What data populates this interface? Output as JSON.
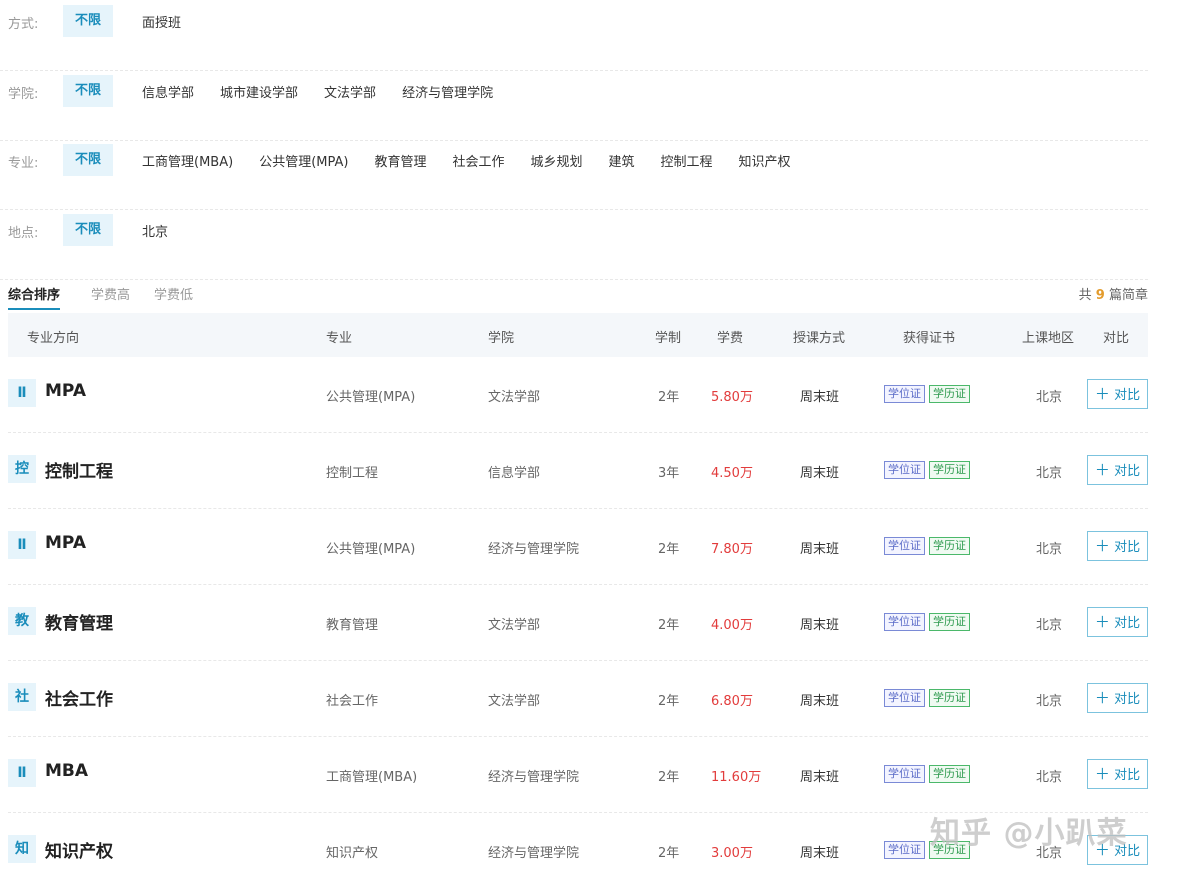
{
  "filters": [
    {
      "label": "方式:",
      "options": [
        "不限",
        "面授班"
      ]
    },
    {
      "label": "学院:",
      "options": [
        "不限",
        "信息学部",
        "城市建设学部",
        "文法学部",
        "经济与管理学院"
      ]
    },
    {
      "label": "专业:",
      "options": [
        "不限",
        "工商管理(MBA)",
        "公共管理(MPA)",
        "教育管理",
        "社会工作",
        "城乡规划",
        "建筑",
        "控制工程",
        "知识产权"
      ]
    },
    {
      "label": "地点:",
      "options": [
        "不限",
        "北京"
      ]
    }
  ],
  "sort": {
    "tabs": [
      "综合排序",
      "学费高",
      "学费低"
    ],
    "count_prefix": "共",
    "count": "9",
    "count_suffix": "篇简章"
  },
  "table": {
    "headers": [
      "专业方向",
      "专业",
      "学院",
      "学制",
      "学费",
      "授课方式",
      "获得证书",
      "上课地区",
      "对比"
    ],
    "rows": [
      {
        "icon": "Ⅱ",
        "title": "MPA",
        "major": "公共管理(MPA)",
        "college": "文法学部",
        "years": "2年",
        "fee": "5.80万",
        "mode": "周末班",
        "certs": [
          "学位证",
          "学历证"
        ],
        "region": "北京",
        "compare": "对比"
      },
      {
        "icon": "控",
        "title": "控制工程",
        "major": "控制工程",
        "college": "信息学部",
        "years": "3年",
        "fee": "4.50万",
        "mode": "周末班",
        "certs": [
          "学位证",
          "学历证"
        ],
        "region": "北京",
        "compare": "对比"
      },
      {
        "icon": "Ⅱ",
        "title": "MPA",
        "major": "公共管理(MPA)",
        "college": "经济与管理学院",
        "years": "2年",
        "fee": "7.80万",
        "mode": "周末班",
        "certs": [
          "学位证",
          "学历证"
        ],
        "region": "北京",
        "compare": "对比"
      },
      {
        "icon": "教",
        "title": "教育管理",
        "major": "教育管理",
        "college": "文法学部",
        "years": "2年",
        "fee": "4.00万",
        "mode": "周末班",
        "certs": [
          "学位证",
          "学历证"
        ],
        "region": "北京",
        "compare": "对比"
      },
      {
        "icon": "社",
        "title": "社会工作",
        "major": "社会工作",
        "college": "文法学部",
        "years": "2年",
        "fee": "6.80万",
        "mode": "周末班",
        "certs": [
          "学位证",
          "学历证"
        ],
        "region": "北京",
        "compare": "对比"
      },
      {
        "icon": "Ⅱ",
        "title": "MBA",
        "major": "工商管理(MBA)",
        "college": "经济与管理学院",
        "years": "2年",
        "fee": "11.60万",
        "mode": "周末班",
        "certs": [
          "学位证",
          "学历证"
        ],
        "region": "北京",
        "compare": "对比"
      },
      {
        "icon": "知",
        "title": "知识产权",
        "major": "知识产权",
        "college": "经济与管理学院",
        "years": "2年",
        "fee": "3.00万",
        "mode": "周末班",
        "certs": [
          "学位证",
          "学历证"
        ],
        "region": "北京",
        "compare": "对比"
      }
    ]
  },
  "watermark": "知乎 @小趴菜",
  "colors": {
    "accent": "#1a8dbb",
    "fee": "#e23c3c",
    "count": "#e39b2c"
  }
}
